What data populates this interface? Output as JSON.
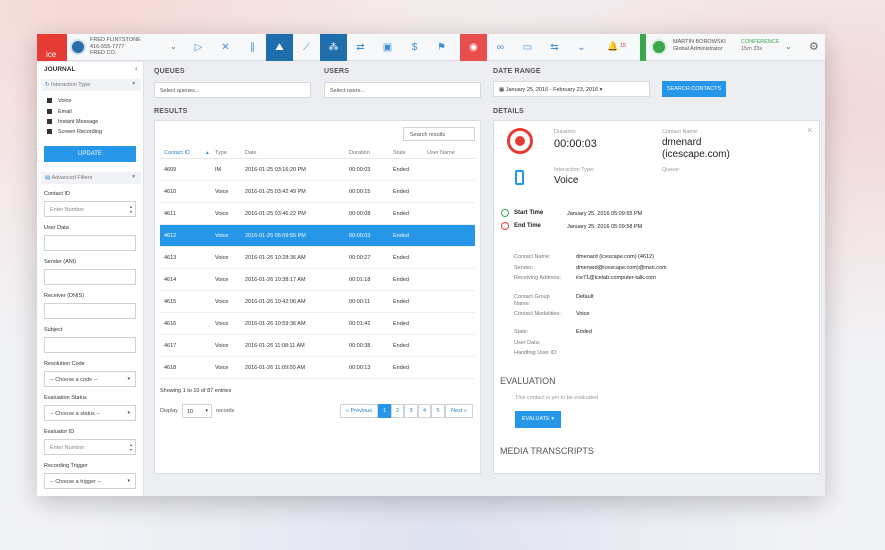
{
  "topbar": {
    "logo": "ice",
    "user_name": "FRED FLINTSTONE",
    "user_phone": "416-555-7777",
    "user_company": "FRED CO.",
    "notif_count": "15",
    "agent_name": "MARTIN BOROWSKI",
    "agent_role": "Global Administrator",
    "conference_label": "CONFERENCE",
    "conference_time": "15m 33s"
  },
  "sidebar": {
    "title": "JOURNAL",
    "interaction_type_label": "Interaction Type",
    "types": [
      "Voice",
      "Email",
      "Instant Message",
      "Screen Recording"
    ],
    "update_label": "UPDATE",
    "advanced_label": "Advanced Filters",
    "contact_id_label": "Contact ID",
    "contact_id_placeholder": "Enter Number",
    "user_data_label": "User Data",
    "sender_label": "Sender (ANI)",
    "receiver_label": "Receiver (DNIS)",
    "subject_label": "Subject",
    "resolution_label": "Resolution Code",
    "resolution_value": "-- Choose a code --",
    "evaluation_label": "Evaluation Status",
    "evaluation_value": "-- Choose a status --",
    "evaluator_label": "Evaluator ID",
    "evaluator_placeholder": "Enter Number",
    "trigger_label": "Recording Trigger",
    "trigger_value": "-- Choose a trigger --"
  },
  "filters": {
    "queues_label": "QUEUES",
    "queues_placeholder": "Select queues...",
    "users_label": "USERS",
    "users_placeholder": "Select users...",
    "date_label": "DATE RANGE",
    "date_value": "January 25, 2016 - February 23, 2016",
    "search_button": "SEARCH CONTACTS"
  },
  "results": {
    "title": "RESULTS",
    "search_label": "Search results",
    "columns": [
      "Contact ID",
      "Type",
      "Date",
      "Duration",
      "State",
      "User Name"
    ],
    "rows": [
      [
        "4609",
        "IM",
        "2016-01-25 03:16:20 PM",
        "00:00:03",
        "Ended",
        ""
      ],
      [
        "4610",
        "Voice",
        "2016-01-25 03:42:49 PM",
        "00:00:15",
        "Ended",
        ""
      ],
      [
        "4611",
        "Voice",
        "2016-01-25 03:46:22 PM",
        "00:00:08",
        "Ended",
        ""
      ],
      [
        "4612",
        "Voice",
        "2016-01-25 05:09:55 PM",
        "00:00:03",
        "Ended",
        ""
      ],
      [
        "4613",
        "Voice",
        "2016-01-26 10:28:36 AM",
        "00:00:27",
        "Ended",
        ""
      ],
      [
        "4614",
        "Voice",
        "2016-01-26 10:38:17 AM",
        "00:01:18",
        "Ended",
        ""
      ],
      [
        "4615",
        "Voice",
        "2016-01-26 10:42:06 AM",
        "00:00:11",
        "Ended",
        ""
      ],
      [
        "4616",
        "Voice",
        "2016-01-26 10:59:36 AM",
        "00:01:42",
        "Ended",
        ""
      ],
      [
        "4617",
        "Voice",
        "2016-01-26 11:08:11 AM",
        "00:00:38",
        "Ended",
        ""
      ],
      [
        "4618",
        "Voice",
        "2016-01-26 11:09:00 AM",
        "00:00:13",
        "Ended",
        ""
      ]
    ],
    "selected_index": 3,
    "showing": "Showing 1 to 10 of 87 entries",
    "display_label": "Display",
    "display_value": "10",
    "records_label": "records",
    "prev_label": "« Previous",
    "pages": [
      "1",
      "2",
      "3",
      "4",
      "5"
    ],
    "next_label": "Next »"
  },
  "details": {
    "title": "DETAILS",
    "close": "×",
    "duration_label": "Duration:",
    "duration_value": "00:00:03",
    "contact_name_label": "Contact Name:",
    "contact_name_value": "dmenard (icescape.com)",
    "interaction_type_label": "Interaction Type:",
    "interaction_type_value": "Voice",
    "queue_label": "Queue:",
    "start_label": "Start Time",
    "start_value": "January 25, 2016 05:09:55 PM",
    "end_label": "End Time",
    "end_value": "January 25, 2016 05:09:58 PM",
    "fields": [
      {
        "label": "Contact Name:",
        "value": "dmenard (icescape.com) (4612)"
      },
      {
        "label": "Sender:",
        "value": "dmenard@icescape.com)@msn.com"
      },
      {
        "label": "Receiving Address:",
        "value": "ice71@icelab.computer-talk.com"
      },
      {
        "label": "Contact Group Name:",
        "value": "Default"
      },
      {
        "label": "Contact Modalities:",
        "value": "Voice"
      },
      {
        "label": "State:",
        "value": "Ended"
      },
      {
        "label": "User Data:",
        "value": ""
      },
      {
        "label": "Handling User ID:",
        "value": ""
      }
    ],
    "evaluation_title": "EVALUATION",
    "evaluation_text": "This contact is yet to be evaluated",
    "evaluate_button": "EVALUATE",
    "media_title": "MEDIA TRANSCRIPTS"
  },
  "colors": {
    "accent": "#2596e8",
    "brand_red": "#e73b35",
    "dark_blue": "#1f6fae",
    "green": "#3aa84a"
  }
}
